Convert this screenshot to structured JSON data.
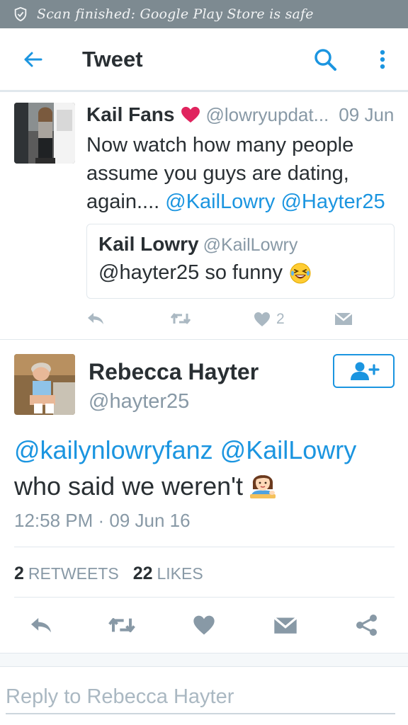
{
  "status_bar": {
    "message": "Scan finished: Google Play Store is safe",
    "icon": "shield-icon"
  },
  "app_bar": {
    "title": "Tweet",
    "back_icon": "back-arrow-icon",
    "search_icon": "search-icon",
    "more_icon": "more-vertical-icon"
  },
  "colors": {
    "accent": "#1b95e0",
    "text": "#292f33",
    "muted": "#8899a6",
    "status_bar": "#7d8a91",
    "heart_red": "#e0245e"
  },
  "parent_tweet": {
    "name": "Kail Fans",
    "handle": "@lowryupdat...",
    "time": "09 Jun",
    "text_before": "Now watch how many people assume you guys are dating, again....",
    "mention_1": "@KailLowry",
    "mention_2": "@Hayter25",
    "quote": {
      "name": "Kail Lowry",
      "handle": "@KailLowry",
      "text": "@hayter25 so funny"
    },
    "like_count": "2"
  },
  "main_tweet": {
    "name": "Rebecca Hayter",
    "handle": "@hayter25",
    "mention_1": "@kailynlowryfanz",
    "mention_2": "@KailLowry",
    "text_after": "who said we weren't",
    "timestamp": "12:58 PM · 09 Jun 16",
    "retweets_count": "2",
    "retweets_label": "RETWEETS",
    "likes_count": "22",
    "likes_label": "LIKES"
  },
  "reply": {
    "placeholder": "Reply to Rebecca Hayter"
  }
}
